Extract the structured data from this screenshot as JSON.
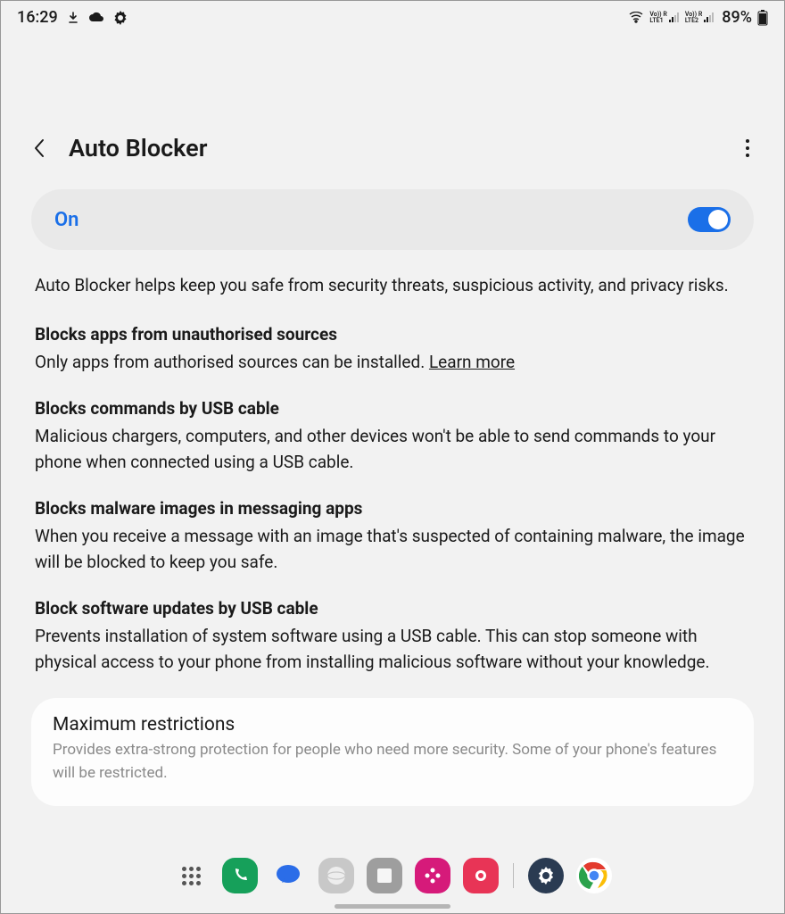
{
  "status": {
    "time": "16:29",
    "sim1": "Vo)) R\nLTE1",
    "sim2": "Vo)) R\nLTE2",
    "battery": "89%"
  },
  "header": {
    "title": "Auto Blocker"
  },
  "toggle": {
    "label": "On",
    "state": true
  },
  "description": "Auto Blocker helps keep you safe from security threats, suspicious activity, and privacy risks.",
  "sections": [
    {
      "title": "Blocks apps from unauthorised sources",
      "text": "Only apps from authorised sources can be installed. ",
      "link": "Learn more"
    },
    {
      "title": "Blocks commands by USB cable",
      "text": "Malicious chargers, computers, and other devices won't be able to send commands to your phone when connected using a USB cable."
    },
    {
      "title": "Blocks malware images in messaging apps",
      "text": "When you receive a message with an image that's suspected of containing malware, the image will be blocked to keep you safe."
    },
    {
      "title": "Block software updates by USB cable",
      "text": "Prevents installation of system software using a USB cable. This can stop someone with physical access to your phone from installing malicious software without your knowledge."
    }
  ],
  "max": {
    "title": "Maximum restrictions",
    "text": "Provides extra-strong protection for people who need more security. Some of your phone's features will be restricted."
  },
  "dock": {
    "apps": [
      "phone",
      "messages",
      "internet",
      "notes",
      "gallery",
      "camera",
      "settings",
      "chrome"
    ]
  }
}
